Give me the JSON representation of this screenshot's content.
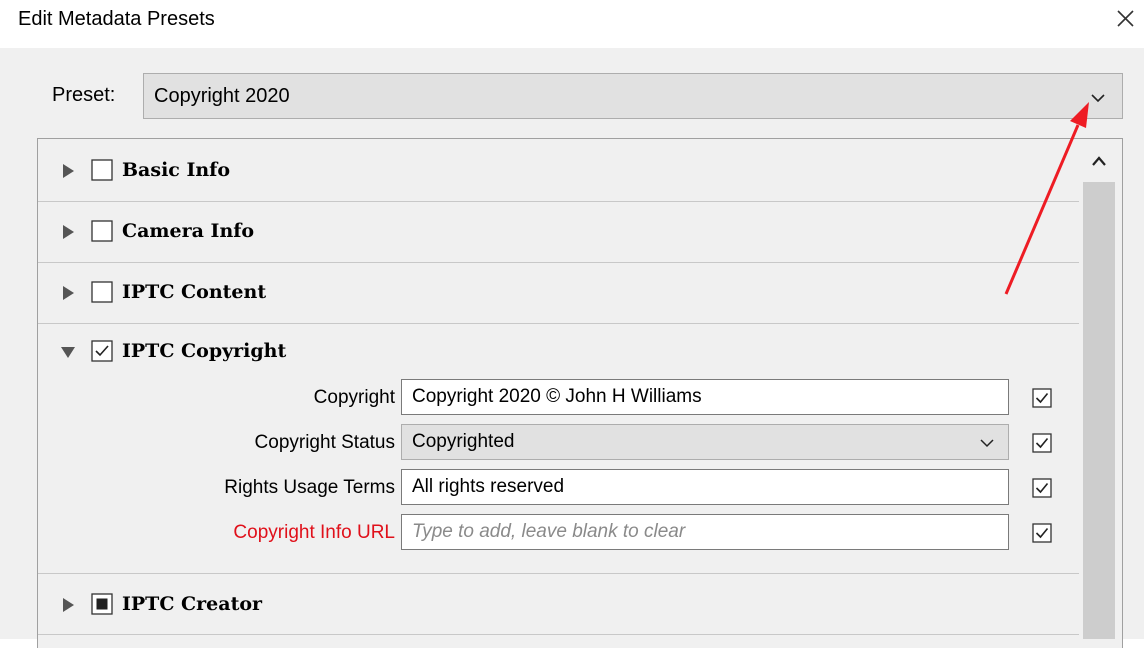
{
  "window": {
    "title": "Edit Metadata Presets",
    "close_icon": "close-icon"
  },
  "preset": {
    "label": "Preset:",
    "value": "Copyright 2020"
  },
  "sections": [
    {
      "label": "Basic Info",
      "expanded": false,
      "checkbox": "unchecked"
    },
    {
      "label": "Camera Info",
      "expanded": false,
      "checkbox": "unchecked"
    },
    {
      "label": "IPTC Content",
      "expanded": false,
      "checkbox": "unchecked"
    },
    {
      "label": "IPTC Copyright",
      "expanded": true,
      "checkbox": "checked"
    },
    {
      "label": "IPTC Creator",
      "expanded": false,
      "checkbox": "mixed"
    }
  ],
  "copyright_fields": [
    {
      "label": "Copyright",
      "value": "Copyright 2020 © John H Williams",
      "type": "text",
      "checked": true
    },
    {
      "label": "Copyright Status",
      "value": "Copyrighted",
      "type": "select",
      "checked": true
    },
    {
      "label": "Rights Usage Terms",
      "value": "All rights reserved",
      "type": "text",
      "checked": true
    },
    {
      "label": "Copyright Info URL",
      "placeholder": "Type to add, leave blank to clear",
      "type": "text",
      "checked": true,
      "label_color": "#e0101a"
    }
  ],
  "colors": {
    "annotation_arrow": "#ee1c24",
    "background": "#f0f0f0",
    "warning_label": "#e0101a"
  }
}
